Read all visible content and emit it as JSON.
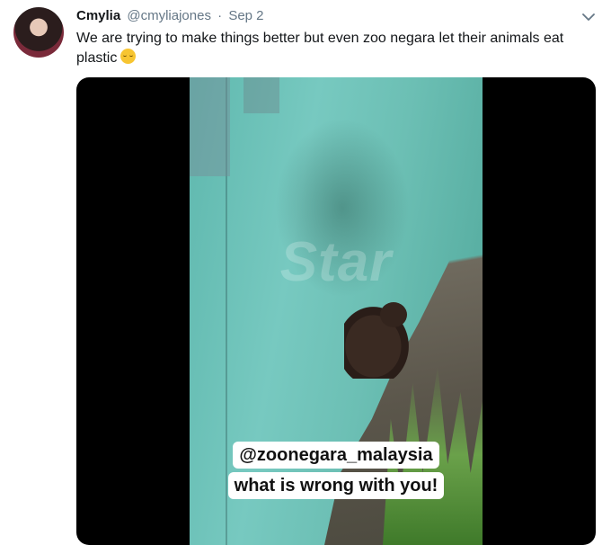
{
  "tweet": {
    "author_name": "Cmylia",
    "handle": "@cmyliajones",
    "separator": "·",
    "date": "Sep 2",
    "text": "We are trying to make things better but even zoo negara let their animals eat plastic",
    "emoji_icon": "relieved-face-emoji",
    "avatar": "profile-photo",
    "menu_icon": "chevron-down-icon"
  },
  "media": {
    "type": "video",
    "watermark": "Star",
    "caption_line1": "@zoonegara_malaysia",
    "caption_line2": "what is wrong with you!"
  },
  "colors": {
    "text": "#14171a",
    "muted": "#657786",
    "media_bg": "#000000",
    "wall": "#6cbfb4"
  }
}
